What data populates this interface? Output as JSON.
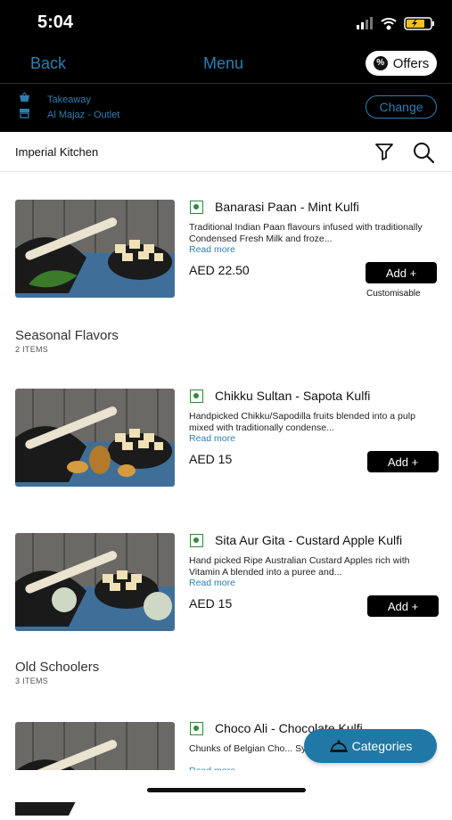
{
  "status": {
    "time": "5:04"
  },
  "nav": {
    "back": "Back",
    "title": "Menu",
    "offers": "Offers"
  },
  "order": {
    "type": "Takeaway",
    "outlet": "Al Majaz - Outlet",
    "change": "Change"
  },
  "restaurant": {
    "name": "Imperial Kitchen"
  },
  "products": [
    {
      "name": "Banarasi Paan  - Mint Kulfi",
      "desc": "Traditional Indian Paan flavours infused with traditionally Condensed Fresh Milk and froze...",
      "more": "Read more",
      "price": "AED 22.50",
      "add": "Add +",
      "customisable": "Customisable"
    },
    {
      "name": "Chikku Sultan - Sapota Kulfi",
      "desc": "Handpicked Chikku/Sapodilla fruits blended into a pulp mixed with traditionally condense...",
      "more": "Read more",
      "price": "AED 15",
      "add": "Add +"
    },
    {
      "name": "Sita Aur Gita - Custard Apple Kulfi",
      "desc": "Hand picked Ripe Australian Custard Apples rich with Vitamin A blended into a puree and...",
      "more": "Read more",
      "price": "AED 15",
      "add": "Add +"
    },
    {
      "name": "Choco Ali - Chocolate Kulfi",
      "desc": "Chunks of Belgian Cho... Syrup perfectly mixed w...",
      "more": "Read more"
    }
  ],
  "sections": [
    {
      "title": "Seasonal Flavors",
      "count": "2 ITEMS"
    },
    {
      "title": "Old Schoolers",
      "count": "3 ITEMS"
    }
  ],
  "categories": {
    "label": "Categories"
  },
  "colors": {
    "accent": "#2c7fb0",
    "veg": "#2e8b3a",
    "categories_bg": "#1f78a6"
  }
}
